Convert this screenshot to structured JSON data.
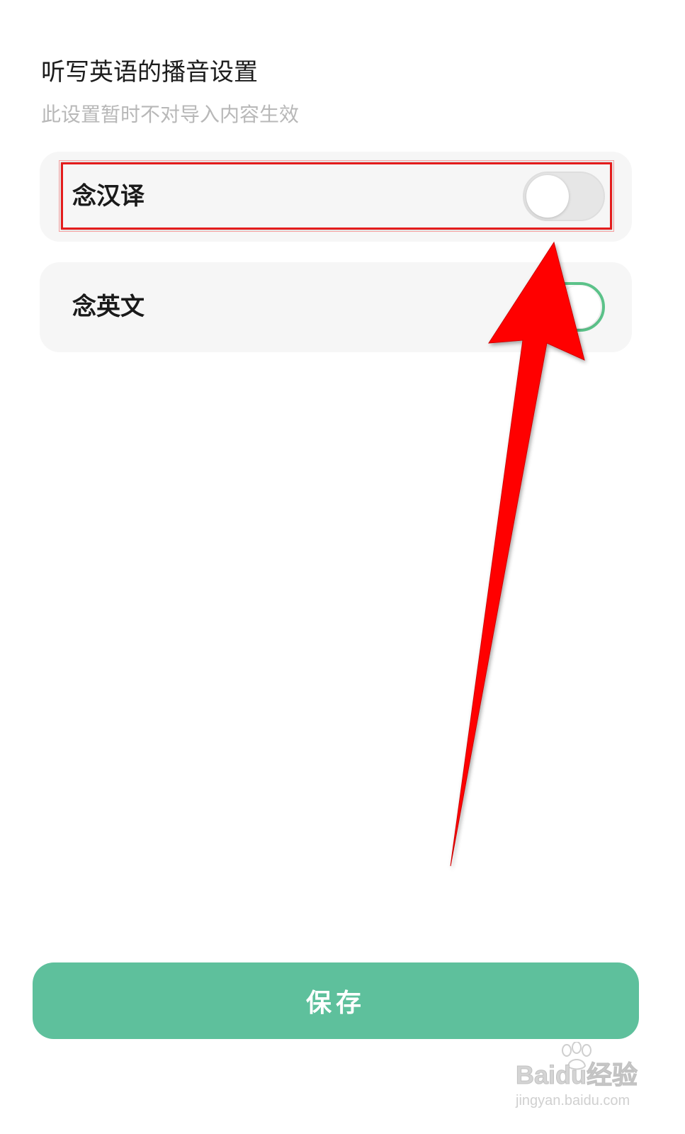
{
  "header": {
    "title": "听写英语的播音设置",
    "subtitle": "此设置暂时不对导入内容生效"
  },
  "settings": [
    {
      "label": "念汉译",
      "enabled": false
    },
    {
      "label": "念英文",
      "enabled": true
    }
  ],
  "save_button": {
    "label": "保存"
  },
  "watermark": {
    "brand": "Baidu经验",
    "url": "jingyan.baidu.com"
  },
  "colors": {
    "accent_green": "#5cc38a",
    "button_green": "#5ec09c",
    "annotation_red": "#e41c1c"
  },
  "icons": {
    "annotation_arrow": "red-arrow-icon",
    "watermark_paw": "baidu-paw-icon"
  }
}
